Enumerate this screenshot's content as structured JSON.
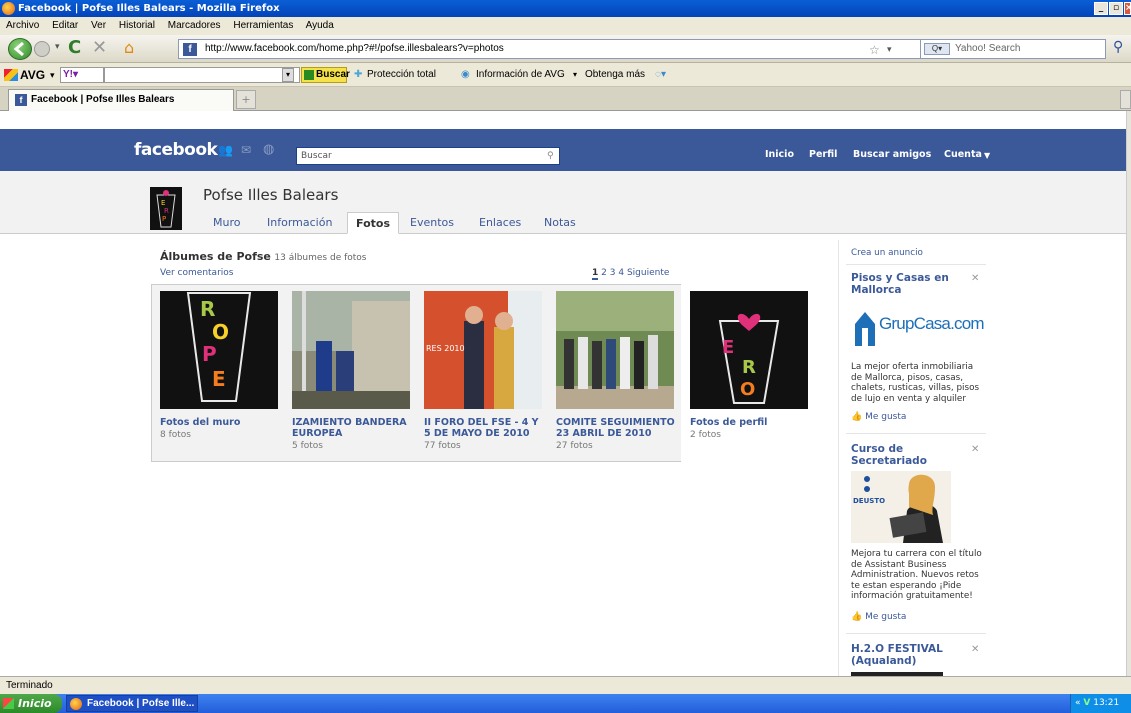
{
  "window": {
    "title": "Facebook | Pofse Illes Balears - Mozilla Firefox"
  },
  "menu": [
    "Archivo",
    "Editar",
    "Ver",
    "Historial",
    "Marcadores",
    "Herramientas",
    "Ayuda"
  ],
  "nav": {
    "url": "http://www.facebook.com/home.php?#!/pofse.illesbalears?v=photos",
    "search_placeholder": "Yahoo! Search"
  },
  "avg": {
    "logo": "AVG",
    "buscar": "Buscar",
    "proteccion": "Protección total",
    "informacion": "Información de AVG",
    "obtenga": "Obtenga más"
  },
  "tab": {
    "title": "Facebook | Pofse Illes Balears"
  },
  "fb": {
    "logo": "facebook",
    "search_placeholder": "Buscar",
    "topnav": [
      "Inicio",
      "Perfil",
      "Buscar amigos",
      "Cuenta"
    ],
    "profile_name": "Pofse Illes Balears",
    "tabs": [
      "Muro",
      "Información",
      "Fotos",
      "Eventos",
      "Enlaces",
      "Notas"
    ],
    "active_tab": "Fotos",
    "albums_heading": "Álbumes de Pofse",
    "albums_count": "13 álbumes de fotos",
    "ver_comentarios": "Ver comentarios",
    "pager": [
      "1",
      "2",
      "3",
      "4",
      "Siguiente"
    ],
    "albums": [
      {
        "title": "Fotos del muro",
        "count": "8 fotos"
      },
      {
        "title": "IZAMIENTO BANDERA EUROPEA",
        "count": "5 fotos"
      },
      {
        "title": "II FORO DEL FSE - 4 Y 5 DE MAYO DE 2010",
        "count": "77 fotos"
      },
      {
        "title": "COMITE SEGUIMIENTO 23 ABRIL DE 2010",
        "count": "27 fotos"
      },
      {
        "title": "Fotos de perfil",
        "count": "2 fotos"
      }
    ],
    "sidebar": {
      "crea": "Crea un anuncio",
      "ads": [
        {
          "title": "Pisos y Casas en Mallorca",
          "brand": "GrupCasa.com",
          "text": "La mejor oferta inmobiliaria de Mallorca, pisos, casas, chalets, rusticas, villas, pisos de lujo en venta y alquiler",
          "like": "Me gusta"
        },
        {
          "title": "Curso de Secretariado",
          "brand": "DEUSTO",
          "text": "Mejora tu carrera con el título de Assistant Business Administration. Nuevos retos te estan esperando ¡Pide información gratuitamente!",
          "like": "Me gusta"
        },
        {
          "title": "H.2.O FESTIVAL (Aqualand)"
        }
      ]
    }
  },
  "status": {
    "text": "Terminado"
  },
  "taskbar": {
    "start": "Inicio",
    "item": "Facebook | Pofse Ille...",
    "time": "13:21"
  },
  "colors": {
    "fb_blue": "#3b5998",
    "xp_title": "#0a5fd6"
  }
}
